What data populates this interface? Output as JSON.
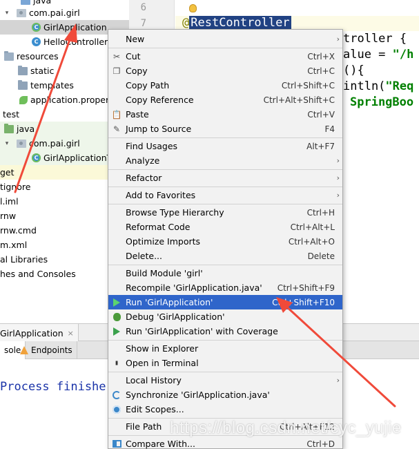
{
  "project_tree": {
    "items": [
      {
        "label": "java",
        "icon": "folder-icon"
      },
      {
        "label": "com.pai.girl",
        "icon": "package-icon"
      },
      {
        "label": "GirlApplication",
        "icon": "spring-class-icon"
      },
      {
        "label": "HelloController",
        "icon": "class-icon"
      },
      {
        "label": "resources",
        "icon": "resources-folder-icon"
      },
      {
        "label": "static",
        "icon": "folder-icon"
      },
      {
        "label": "templates",
        "icon": "folder-icon"
      },
      {
        "label": "application.propert",
        "icon": "spring-leaf-icon"
      },
      {
        "label": "test",
        "icon": "none"
      },
      {
        "label": "java",
        "icon": "test-folder-icon"
      },
      {
        "label": "com.pai.girl",
        "icon": "package-icon"
      },
      {
        "label": "GirlApplicationTe",
        "icon": "spring-class-icon"
      },
      {
        "label": "get",
        "icon": "none"
      },
      {
        "label": "tignore",
        "icon": "none"
      },
      {
        "label": "l.iml",
        "icon": "none"
      },
      {
        "label": "rnw",
        "icon": "none"
      },
      {
        "label": "rnw.cmd",
        "icon": "none"
      },
      {
        "label": "m.xml",
        "icon": "none"
      },
      {
        "label": "al Libraries",
        "icon": "none"
      },
      {
        "label": "hes and Consoles",
        "icon": "none"
      }
    ]
  },
  "editor": {
    "line_numbers": [
      "6",
      "7"
    ],
    "annotation_at": "@",
    "annotation_name": "RestController",
    "code_fragments": {
      "line8": "troller {",
      "line9_a": "alue = ",
      "line9_b": "\"/h",
      "line10": "(){",
      "line11_a": "intln(",
      "line11_b": "\"Req",
      "line12": "SpringBoo"
    }
  },
  "bottom_panel": {
    "run_tab": "GirlApplication",
    "close_glyph": "×",
    "subtabs": [
      "sole",
      "Endpoints"
    ],
    "console_output": "Process finishe"
  },
  "context_menu": {
    "items": [
      {
        "label": "New",
        "shortcut": "",
        "submenu": true,
        "icon": ""
      },
      {
        "label": "Cut",
        "shortcut": "Ctrl+X",
        "icon": "cut-icon"
      },
      {
        "label": "Copy",
        "shortcut": "Ctrl+C",
        "icon": "copy-icon"
      },
      {
        "label": "Copy Path",
        "shortcut": "Ctrl+Shift+C",
        "icon": ""
      },
      {
        "label": "Copy Reference",
        "shortcut": "Ctrl+Alt+Shift+C",
        "icon": ""
      },
      {
        "label": "Paste",
        "shortcut": "Ctrl+V",
        "icon": "paste-icon"
      },
      {
        "label": "Jump to Source",
        "shortcut": "F4",
        "icon": "edit-icon"
      },
      {
        "label": "Find Usages",
        "shortcut": "Alt+F7",
        "icon": ""
      },
      {
        "label": "Analyze",
        "shortcut": "",
        "submenu": true,
        "icon": ""
      },
      {
        "label": "Refactor",
        "shortcut": "",
        "submenu": true,
        "icon": ""
      },
      {
        "label": "Add to Favorites",
        "shortcut": "",
        "submenu": true,
        "icon": ""
      },
      {
        "label": "Browse Type Hierarchy",
        "shortcut": "Ctrl+H",
        "icon": ""
      },
      {
        "label": "Reformat Code",
        "shortcut": "Ctrl+Alt+L",
        "icon": ""
      },
      {
        "label": "Optimize Imports",
        "shortcut": "Ctrl+Alt+O",
        "icon": ""
      },
      {
        "label": "Delete...",
        "shortcut": "Delete",
        "icon": ""
      },
      {
        "label": "Build Module 'girl'",
        "shortcut": "",
        "icon": ""
      },
      {
        "label": "Recompile 'GirlApplication.java'",
        "shortcut": "Ctrl+Shift+F9",
        "icon": ""
      },
      {
        "label": "Run 'GirlApplication'",
        "shortcut": "Ctrl+Shift+F10",
        "icon": "run-icon",
        "highlighted": true
      },
      {
        "label": "Debug 'GirlApplication'",
        "shortcut": "",
        "icon": "debug-icon"
      },
      {
        "label": "Run 'GirlApplication' with Coverage",
        "shortcut": "",
        "icon": "coverage-icon"
      },
      {
        "label": "Show in Explorer",
        "shortcut": "",
        "icon": ""
      },
      {
        "label": "Open in Terminal",
        "shortcut": "",
        "icon": "terminal-icon"
      },
      {
        "label": "Local History",
        "shortcut": "",
        "submenu": true,
        "icon": ""
      },
      {
        "label": "Synchronize 'GirlApplication.java'",
        "shortcut": "",
        "icon": "sync-icon"
      },
      {
        "label": "Edit Scopes...",
        "shortcut": "",
        "icon": "scopes-icon"
      },
      {
        "label": "File Path",
        "shortcut": "Ctrl+Alt+F12",
        "icon": ""
      },
      {
        "label": "Compare With...",
        "shortcut": "Ctrl+D",
        "icon": "compare-icon"
      }
    ],
    "submenu_glyph": "›"
  },
  "watermark": "https://blog.csdn.net/cyc_yujie",
  "colors": {
    "menu_highlight": "#2f65ca",
    "annotation_arrow": "#f04a3a",
    "selection_bg": "#214283",
    "console_text": "#1a33a8"
  }
}
